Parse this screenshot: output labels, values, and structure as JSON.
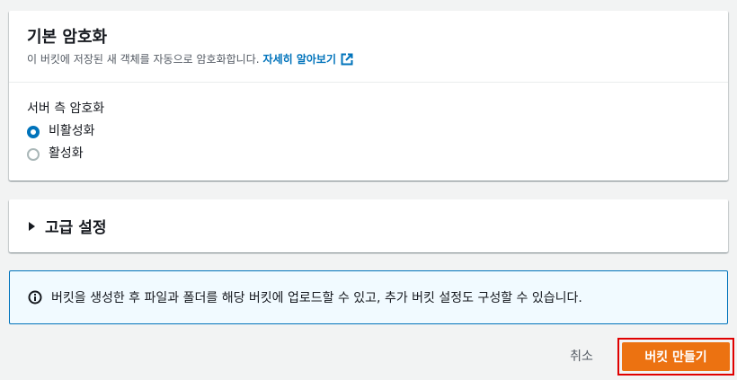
{
  "encryption": {
    "title": "기본 암호화",
    "description": "이 버킷에 저장된 새 객체를 자동으로 암호화합니다.",
    "learn_more": "자세히 알아보기",
    "field_label": "서버 측 암호화",
    "options": [
      {
        "label": "비활성화",
        "selected": true
      },
      {
        "label": "활성화",
        "selected": false
      }
    ]
  },
  "advanced": {
    "title": "고급 설정",
    "expanded": false
  },
  "info": {
    "icon": "info-icon",
    "text": "버킷을 생성한 후 파일과 폴더를 해당 버킷에 업로드할 수 있고, 추가 버킷 설정도 구성할 수 있습니다."
  },
  "footer": {
    "cancel_label": "취소",
    "create_label": "버킷 만들기"
  },
  "colors": {
    "primary": "#ec7211",
    "link": "#0073bb",
    "highlight": "#e00000",
    "info_bg": "#f1faff"
  }
}
